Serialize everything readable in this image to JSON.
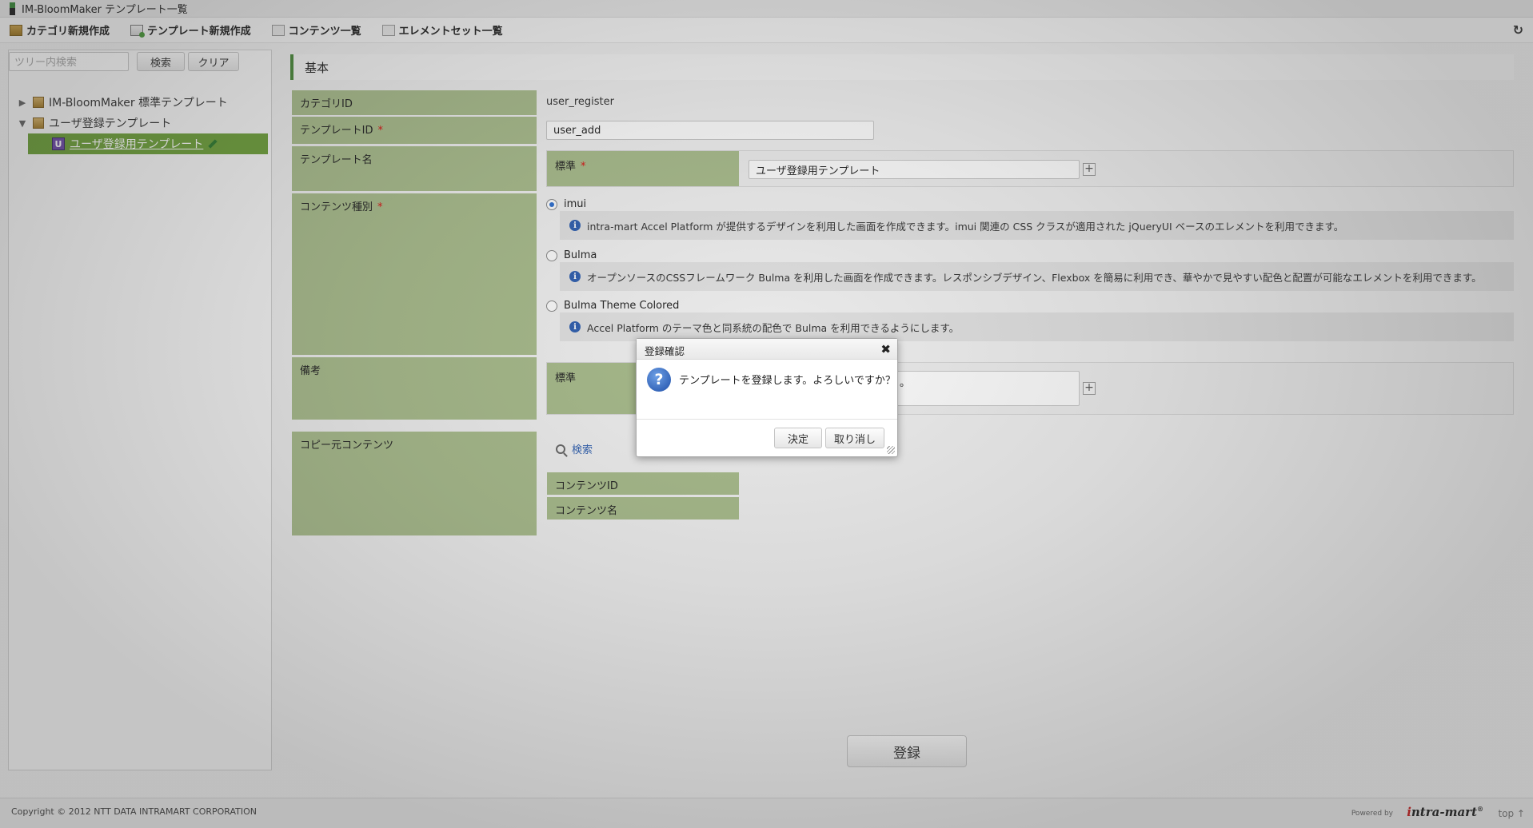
{
  "window": {
    "title": "IM-BloomMaker テンプレート一覧"
  },
  "toolbar": {
    "items": [
      {
        "label": "カテゴリ新規作成",
        "icon": "category-icon"
      },
      {
        "label": "テンプレート新規作成",
        "icon": "template-add-icon"
      },
      {
        "label": "コンテンツ一覧",
        "icon": "list-icon"
      },
      {
        "label": "エレメントセット一覧",
        "icon": "list-icon"
      }
    ],
    "refresh_icon": "refresh-icon",
    "refresh_glyph": "↻"
  },
  "sidebar": {
    "search_placeholder": "ツリー内検索",
    "search_button": "検索",
    "clear_button": "クリア",
    "tree": [
      {
        "label": "IM-BloomMaker 標準テンプレート",
        "expanded": false,
        "arrow": "▶"
      },
      {
        "label": "ユーザ登録テンプレート",
        "expanded": true,
        "arrow": "▼"
      }
    ],
    "selected_leaf": {
      "label": "ユーザ登録用テンプレート",
      "badge": "U"
    }
  },
  "form": {
    "section_title": "基本",
    "category_id": {
      "label": "カテゴリID",
      "value": "user_register"
    },
    "template_id": {
      "label": "テンプレートID",
      "value": "user_add",
      "required": "*"
    },
    "template_name": {
      "label": "テンプレート名",
      "locale_label": "標準",
      "value": "ユーザ登録用テンプレート",
      "required": "*"
    },
    "content_type": {
      "label": "コンテンツ種別",
      "required": "*",
      "options": [
        {
          "label": "imui",
          "checked": true,
          "description": "intra-mart Accel Platform が提供するデザインを利用した画面を作成できます。imui 関連の CSS クラスが適用された jQueryUI ベースのエレメントを利用できます。"
        },
        {
          "label": "Bulma",
          "checked": false,
          "description": "オープンソースのCSSフレームワーク Bulma を利用した画面を作成できます。レスポンシブデザイン、Flexbox を簡易に利用でき、華やかで見やすい配色と配置が可能なエレメントを利用できます。"
        },
        {
          "label": "Bulma Theme Colored",
          "checked": false,
          "description": "Accel Platform のテーマ色と同系統の配色で Bulma を利用できるようにします。"
        }
      ]
    },
    "remarks": {
      "label": "備考",
      "locale_label": "標準",
      "value_fragment": "。"
    },
    "copy_source": {
      "label": "コピー元コンテンツ",
      "search_label": "検索",
      "content_id_label": "コンテンツID",
      "content_name_label": "コンテンツ名"
    },
    "plus": "+",
    "info": "i",
    "register_button": "登録"
  },
  "dialog": {
    "title": "登録確認",
    "close": "✖",
    "icon": "question-icon",
    "icon_glyph": "?",
    "message": "テンプレートを登録します。よろしいですか？",
    "ok_button": "決定",
    "cancel_button": "取り消し"
  },
  "footer": {
    "copyright": "Copyright © 2012 NTT DATA INTRAMART CORPORATION",
    "powered_by": "Powered by",
    "brand_i": "i",
    "brand_rest": "ntra-mart",
    "brand_mark": "®",
    "top_link": "top ↑"
  },
  "colors": {
    "label_bg": "#a9bd8c",
    "accent": "#4a8a3a",
    "selected_leaf": "#6ea13a",
    "link": "#2e5fb0"
  }
}
